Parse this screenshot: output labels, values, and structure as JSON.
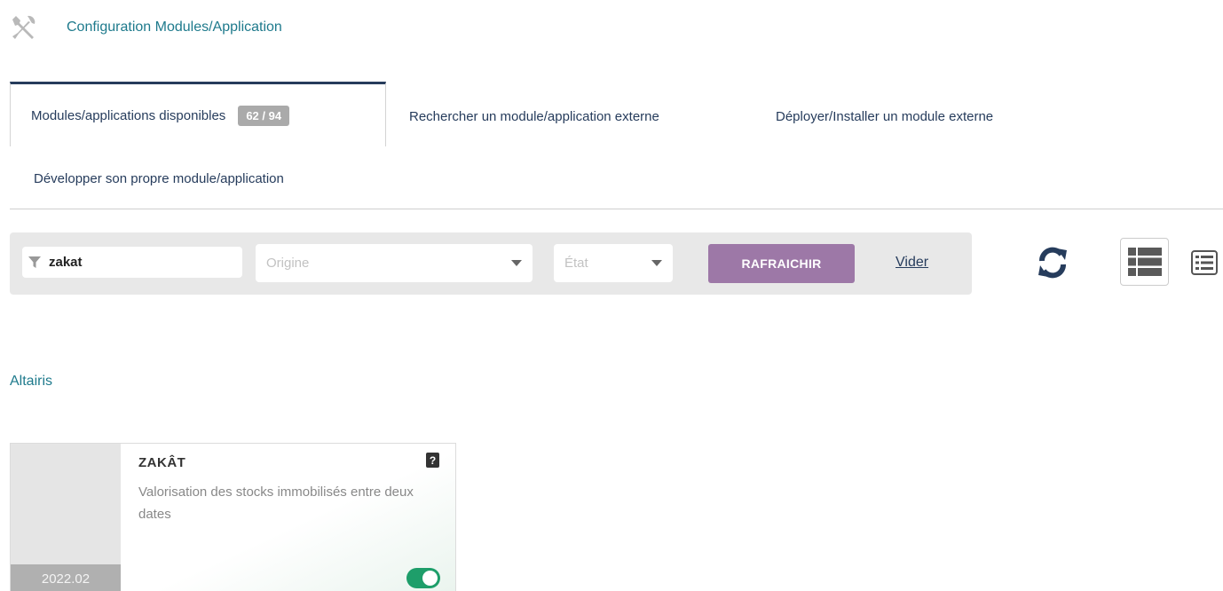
{
  "header": {
    "title": "Configuration Modules/Application",
    "icon": "tools-icon"
  },
  "tabs": [
    {
      "label": "Modules/applications disponibles",
      "badge": "62 / 94",
      "active": true
    },
    {
      "label": "Rechercher un module/application externe"
    },
    {
      "label": "Déployer/Installer un module externe"
    },
    {
      "label": "Développer son propre module/application"
    }
  ],
  "filters": {
    "search_value": "zakat",
    "origin_placeholder": "Origine",
    "state_placeholder": "État",
    "refresh_label": "RAFRAICHIR",
    "clear_label": "Vider"
  },
  "group": {
    "name": "Altairis"
  },
  "modules": [
    {
      "name": "ZAKÂT",
      "description": "Valorisation des stocks immobilisés entre deux dates",
      "version": "2022.02",
      "enabled": true,
      "help": "?"
    }
  ],
  "colors": {
    "accent_teal": "#1e7a8c",
    "navy": "#263c5c",
    "button_purple": "#9d78a7",
    "toggle_green": "#1e9e6a"
  }
}
